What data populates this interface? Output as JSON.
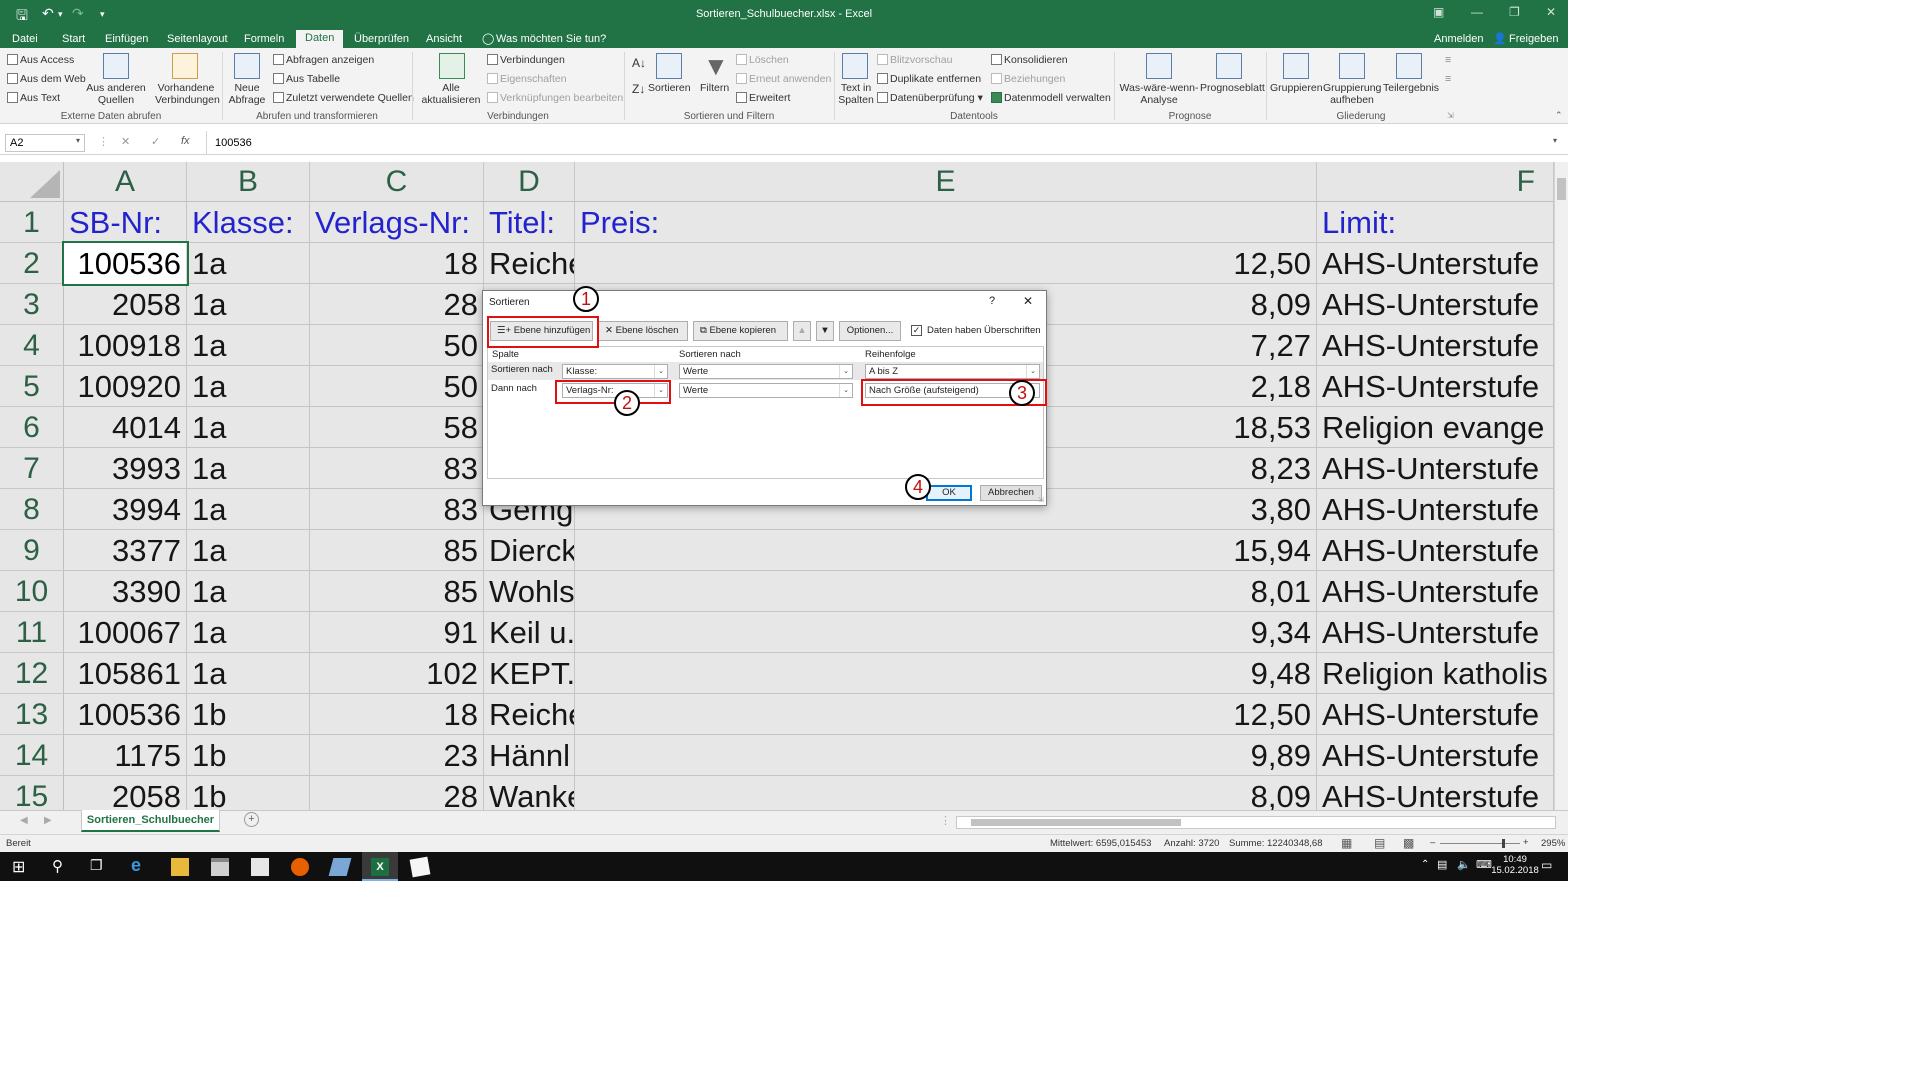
{
  "window": {
    "title": "Sortieren_Schulbuecher.xlsx - Excel"
  },
  "ribbon_tabs": [
    "Datei",
    "Start",
    "Einfügen",
    "Seitenlayout",
    "Formeln",
    "Daten",
    "Überprüfen",
    "Ansicht"
  ],
  "ribbon_right": {
    "tell_me": "Was möchten Sie tun?",
    "signin": "Anmelden",
    "share": "Freigeben"
  },
  "ribbon": {
    "external": {
      "access": "Aus Access",
      "web": "Aus dem Web",
      "text": "Aus Text",
      "other": "Aus anderen Quellen",
      "existing": "Vorhandene Verbindungen",
      "group": "Externe Daten abrufen"
    },
    "transform": {
      "new_query": "Neue Abfrage",
      "show_queries": "Abfragen anzeigen",
      "from_table": "Aus Tabelle",
      "recent": "Zuletzt verwendete Quellen",
      "group": "Abrufen und transformieren"
    },
    "connections": {
      "refresh": "Alle aktualisieren",
      "connections": "Verbindungen",
      "properties": "Eigenschaften",
      "edit_links": "Verknüpfungen bearbeiten",
      "group": "Verbindungen"
    },
    "sortfilter": {
      "sort": "Sortieren",
      "filter": "Filtern",
      "clear": "Löschen",
      "reapply": "Erneut anwenden",
      "advanced": "Erweitert",
      "group": "Sortieren und Filtern"
    },
    "datatools": {
      "text_to_cols": "Text in Spalten",
      "flash": "Blitzvorschau",
      "dupes": "Duplikate entfernen",
      "validation": "Datenüberprüfung",
      "consolidate": "Konsolidieren",
      "relations": "Beziehungen",
      "model": "Datenmodell verwalten",
      "group": "Datentools"
    },
    "forecast": {
      "whatif": "Was-wäre-wenn-Analyse",
      "sheet": "Prognoseblatt",
      "group": "Prognose"
    },
    "outline": {
      "group_btn": "Gruppieren",
      "ungroup": "Gruppierung aufheben",
      "subtotal": "Teilergebnis",
      "group": "Gliederung"
    }
  },
  "formula_bar": {
    "namebox": "A2",
    "fx": "fx",
    "value": "100536"
  },
  "columns": [
    "A",
    "B",
    "C",
    "D",
    "E",
    "F"
  ],
  "header_row": {
    "num": "1",
    "cells": [
      "SB-Nr:",
      "Klasse:",
      "Verlags-Nr:",
      "Titel:",
      "Preis:",
      "Limit:"
    ]
  },
  "rows": [
    {
      "num": "2",
      "a": "100536",
      "b": "1a",
      "c": "18",
      "d": "Reiche",
      "e": "12,50",
      "f": "AHS-Unterstufe"
    },
    {
      "num": "3",
      "a": "2058",
      "b": "1a",
      "c": "28",
      "d": "",
      "e": "8,09",
      "f": "AHS-Unterstufe"
    },
    {
      "num": "4",
      "a": "100918",
      "b": "1a",
      "c": "50",
      "d": "",
      "e": "7,27",
      "f": "AHS-Unterstufe"
    },
    {
      "num": "5",
      "a": "100920",
      "b": "1a",
      "c": "50",
      "d": "",
      "e": "2,18",
      "f": "AHS-Unterstufe"
    },
    {
      "num": "6",
      "a": "4014",
      "b": "1a",
      "c": "58",
      "d": "",
      "e": "18,53",
      "f": "Religion evange"
    },
    {
      "num": "7",
      "a": "3993",
      "b": "1a",
      "c": "83",
      "d": "",
      "e": "8,23",
      "f": "AHS-Unterstufe"
    },
    {
      "num": "8",
      "a": "3994",
      "b": "1a",
      "c": "83",
      "d": "Gemg",
      "e": "3,80",
      "f": "AHS-Unterstufe"
    },
    {
      "num": "9",
      "a": "3377",
      "b": "1a",
      "c": "85",
      "d": "Dierck",
      "e": "15,94",
      "f": "AHS-Unterstufe"
    },
    {
      "num": "10",
      "a": "3390",
      "b": "1a",
      "c": "85",
      "d": "Wohls",
      "e": "8,01",
      "f": "AHS-Unterstufe"
    },
    {
      "num": "11",
      "a": "100067",
      "b": "1a",
      "c": "91",
      "d": "Keil u.",
      "e": "9,34",
      "f": "AHS-Unterstufe"
    },
    {
      "num": "12",
      "a": "105861",
      "b": "1a",
      "c": "102",
      "d": "KEPT.",
      "e": "9,48",
      "f": "Religion katholis"
    },
    {
      "num": "13",
      "a": "100536",
      "b": "1b",
      "c": "18",
      "d": "Reiche",
      "e": "12,50",
      "f": "AHS-Unterstufe"
    },
    {
      "num": "14",
      "a": "1175",
      "b": "1b",
      "c": "23",
      "d": "Hännl",
      "e": "9,89",
      "f": "AHS-Unterstufe"
    },
    {
      "num": "15",
      "a": "2058",
      "b": "1b",
      "c": "28",
      "d": "Wanke",
      "e": "8,09",
      "f": "AHS-Unterstufe"
    }
  ],
  "dialog": {
    "title": "Sortieren",
    "help": "?",
    "close": "✕",
    "add_level": "Ebene hinzufügen",
    "delete_level": "Ebene löschen",
    "copy_level": "Ebene kopieren",
    "options": "Optionen...",
    "headers_checkbox": "Daten haben Überschriften",
    "col_header": "Spalte",
    "sorton_header": "Sortieren nach",
    "order_header": "Reihenfolge",
    "level1": {
      "label": "Sortieren nach",
      "column": "Klasse:",
      "sorton": "Werte",
      "order": "A bis Z"
    },
    "level2": {
      "label": "Dann nach",
      "column": "Verlags-Nr:",
      "sorton": "Werte",
      "order": "Nach Größe (aufsteigend)"
    },
    "ok": "OK",
    "cancel": "Abbrechen",
    "markers": [
      "1",
      "2",
      "3",
      "4"
    ]
  },
  "sheet_tab": "Sortieren_Schulbuecher",
  "status": {
    "ready": "Bereit",
    "average": "Mittelwert: 6595,015453",
    "count": "Anzahl: 3720",
    "sum": "Summe: 12240348,68",
    "zoom": "295%"
  },
  "taskbar": {
    "time": "10:49",
    "date": "15.02.2018"
  },
  "colors": {
    "excel_green": "#217346",
    "header_blue": "#1010e0",
    "annotation_red": "#e01010"
  }
}
